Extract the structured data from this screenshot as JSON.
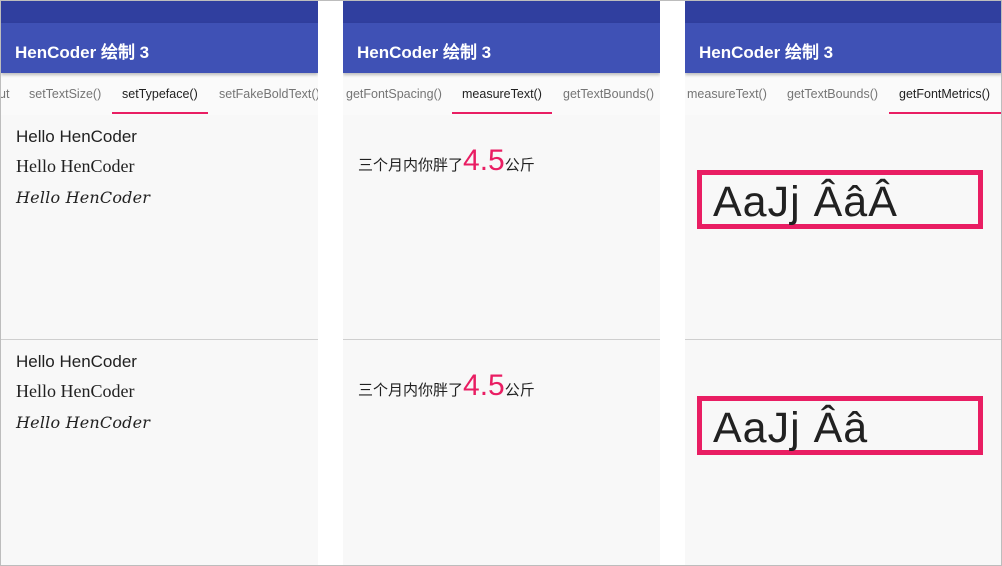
{
  "app_title": "HenCoder 绘制 3",
  "colors": {
    "primary": "#3f51b5",
    "primary_dark": "#303f9f",
    "accent": "#e91e63"
  },
  "screen1": {
    "tabs": [
      "ut",
      "setTextSize()",
      "setTypeface()",
      "setFakeBoldText()"
    ],
    "active_tab": "setTypeface()",
    "panels": [
      {
        "sans": "Hello HenCoder",
        "serif": "Hello HenCoder",
        "script": "Hello HenCoder"
      },
      {
        "sans": "Hello HenCoder",
        "serif": "Hello HenCoder",
        "script": "Hello HenCoder"
      }
    ]
  },
  "screen2": {
    "tabs": [
      "getFontSpacing()",
      "measureText()",
      "getTextBounds()"
    ],
    "active_tab": "measureText()",
    "panels": [
      {
        "prefix": "三个月内你胖了",
        "number": "4.5",
        "unit": "公斤"
      },
      {
        "prefix": "三个月内你胖了",
        "number": "4.5",
        "unit": "公斤"
      }
    ]
  },
  "screen3": {
    "tabs": [
      "measureText()",
      "getTextBounds()",
      "getFontMetrics()"
    ],
    "active_tab": "getFontMetrics()",
    "panels": [
      {
        "sample": "AaJj ÂâÂ"
      },
      {
        "sample": "AaJj Ââ"
      }
    ]
  }
}
